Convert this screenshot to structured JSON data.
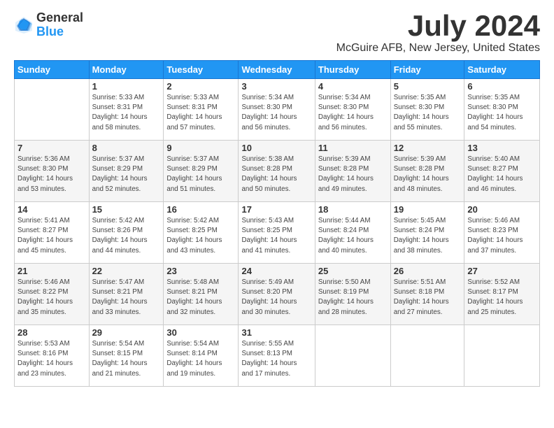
{
  "header": {
    "logo_line1": "General",
    "logo_line2": "Blue",
    "month": "July 2024",
    "location": "McGuire AFB, New Jersey, United States"
  },
  "weekdays": [
    "Sunday",
    "Monday",
    "Tuesday",
    "Wednesday",
    "Thursday",
    "Friday",
    "Saturday"
  ],
  "weeks": [
    [
      {
        "day": "",
        "info": ""
      },
      {
        "day": "1",
        "info": "Sunrise: 5:33 AM\nSunset: 8:31 PM\nDaylight: 14 hours\nand 58 minutes."
      },
      {
        "day": "2",
        "info": "Sunrise: 5:33 AM\nSunset: 8:31 PM\nDaylight: 14 hours\nand 57 minutes."
      },
      {
        "day": "3",
        "info": "Sunrise: 5:34 AM\nSunset: 8:30 PM\nDaylight: 14 hours\nand 56 minutes."
      },
      {
        "day": "4",
        "info": "Sunrise: 5:34 AM\nSunset: 8:30 PM\nDaylight: 14 hours\nand 56 minutes."
      },
      {
        "day": "5",
        "info": "Sunrise: 5:35 AM\nSunset: 8:30 PM\nDaylight: 14 hours\nand 55 minutes."
      },
      {
        "day": "6",
        "info": "Sunrise: 5:35 AM\nSunset: 8:30 PM\nDaylight: 14 hours\nand 54 minutes."
      }
    ],
    [
      {
        "day": "7",
        "info": "Sunrise: 5:36 AM\nSunset: 8:30 PM\nDaylight: 14 hours\nand 53 minutes."
      },
      {
        "day": "8",
        "info": "Sunrise: 5:37 AM\nSunset: 8:29 PM\nDaylight: 14 hours\nand 52 minutes."
      },
      {
        "day": "9",
        "info": "Sunrise: 5:37 AM\nSunset: 8:29 PM\nDaylight: 14 hours\nand 51 minutes."
      },
      {
        "day": "10",
        "info": "Sunrise: 5:38 AM\nSunset: 8:28 PM\nDaylight: 14 hours\nand 50 minutes."
      },
      {
        "day": "11",
        "info": "Sunrise: 5:39 AM\nSunset: 8:28 PM\nDaylight: 14 hours\nand 49 minutes."
      },
      {
        "day": "12",
        "info": "Sunrise: 5:39 AM\nSunset: 8:28 PM\nDaylight: 14 hours\nand 48 minutes."
      },
      {
        "day": "13",
        "info": "Sunrise: 5:40 AM\nSunset: 8:27 PM\nDaylight: 14 hours\nand 46 minutes."
      }
    ],
    [
      {
        "day": "14",
        "info": "Sunrise: 5:41 AM\nSunset: 8:27 PM\nDaylight: 14 hours\nand 45 minutes."
      },
      {
        "day": "15",
        "info": "Sunrise: 5:42 AM\nSunset: 8:26 PM\nDaylight: 14 hours\nand 44 minutes."
      },
      {
        "day": "16",
        "info": "Sunrise: 5:42 AM\nSunset: 8:25 PM\nDaylight: 14 hours\nand 43 minutes."
      },
      {
        "day": "17",
        "info": "Sunrise: 5:43 AM\nSunset: 8:25 PM\nDaylight: 14 hours\nand 41 minutes."
      },
      {
        "day": "18",
        "info": "Sunrise: 5:44 AM\nSunset: 8:24 PM\nDaylight: 14 hours\nand 40 minutes."
      },
      {
        "day": "19",
        "info": "Sunrise: 5:45 AM\nSunset: 8:24 PM\nDaylight: 14 hours\nand 38 minutes."
      },
      {
        "day": "20",
        "info": "Sunrise: 5:46 AM\nSunset: 8:23 PM\nDaylight: 14 hours\nand 37 minutes."
      }
    ],
    [
      {
        "day": "21",
        "info": "Sunrise: 5:46 AM\nSunset: 8:22 PM\nDaylight: 14 hours\nand 35 minutes."
      },
      {
        "day": "22",
        "info": "Sunrise: 5:47 AM\nSunset: 8:21 PM\nDaylight: 14 hours\nand 33 minutes."
      },
      {
        "day": "23",
        "info": "Sunrise: 5:48 AM\nSunset: 8:21 PM\nDaylight: 14 hours\nand 32 minutes."
      },
      {
        "day": "24",
        "info": "Sunrise: 5:49 AM\nSunset: 8:20 PM\nDaylight: 14 hours\nand 30 minutes."
      },
      {
        "day": "25",
        "info": "Sunrise: 5:50 AM\nSunset: 8:19 PM\nDaylight: 14 hours\nand 28 minutes."
      },
      {
        "day": "26",
        "info": "Sunrise: 5:51 AM\nSunset: 8:18 PM\nDaylight: 14 hours\nand 27 minutes."
      },
      {
        "day": "27",
        "info": "Sunrise: 5:52 AM\nSunset: 8:17 PM\nDaylight: 14 hours\nand 25 minutes."
      }
    ],
    [
      {
        "day": "28",
        "info": "Sunrise: 5:53 AM\nSunset: 8:16 PM\nDaylight: 14 hours\nand 23 minutes."
      },
      {
        "day": "29",
        "info": "Sunrise: 5:54 AM\nSunset: 8:15 PM\nDaylight: 14 hours\nand 21 minutes."
      },
      {
        "day": "30",
        "info": "Sunrise: 5:54 AM\nSunset: 8:14 PM\nDaylight: 14 hours\nand 19 minutes."
      },
      {
        "day": "31",
        "info": "Sunrise: 5:55 AM\nSunset: 8:13 PM\nDaylight: 14 hours\nand 17 minutes."
      },
      {
        "day": "",
        "info": ""
      },
      {
        "day": "",
        "info": ""
      },
      {
        "day": "",
        "info": ""
      }
    ]
  ]
}
